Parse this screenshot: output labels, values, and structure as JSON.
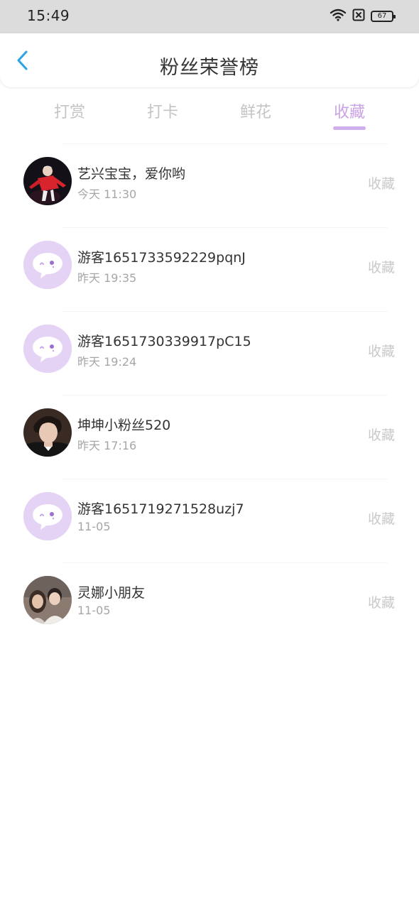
{
  "status_bar": {
    "time": "15:49",
    "battery": "67",
    "icons": [
      "wifi-icon",
      "sim-blocked-icon",
      "battery-icon"
    ]
  },
  "header": {
    "title": "粉丝荣誉榜",
    "back_icon": "chevron-left-icon"
  },
  "tabs": [
    {
      "label": "打赏",
      "active": false
    },
    {
      "label": "打卡",
      "active": false
    },
    {
      "label": "鲜花",
      "active": false
    },
    {
      "label": "收藏",
      "active": true
    }
  ],
  "fans": [
    {
      "name": "艺兴宝宝，爱你哟",
      "time": "今天 11:30",
      "action": "收藏",
      "avatar": "photo-red-jacket"
    },
    {
      "name": "游客1651733592229pqnJ",
      "time": "昨天 19:35",
      "action": "收藏",
      "avatar": "guest-chat-icon"
    },
    {
      "name": "游客1651730339917pC15",
      "time": "昨天 19:24",
      "action": "收藏",
      "avatar": "guest-chat-icon"
    },
    {
      "name": "坤坤小粉丝520",
      "time": "昨天 17:16",
      "action": "收藏",
      "avatar": "photo-portrait"
    },
    {
      "name": "游客1651719271528uzj7",
      "time": "11-05",
      "action": "收藏",
      "avatar": "guest-chat-icon"
    },
    {
      "name": "灵娜小朋友",
      "time": "11-05",
      "action": "收藏",
      "avatar": "photo-couple"
    }
  ],
  "colors": {
    "accent": "#c9a3e6",
    "back_arrow": "#2aa3e8",
    "status_bar_bg": "#dcdcdc",
    "guest_avatar_bg": "#e5d3f6"
  }
}
